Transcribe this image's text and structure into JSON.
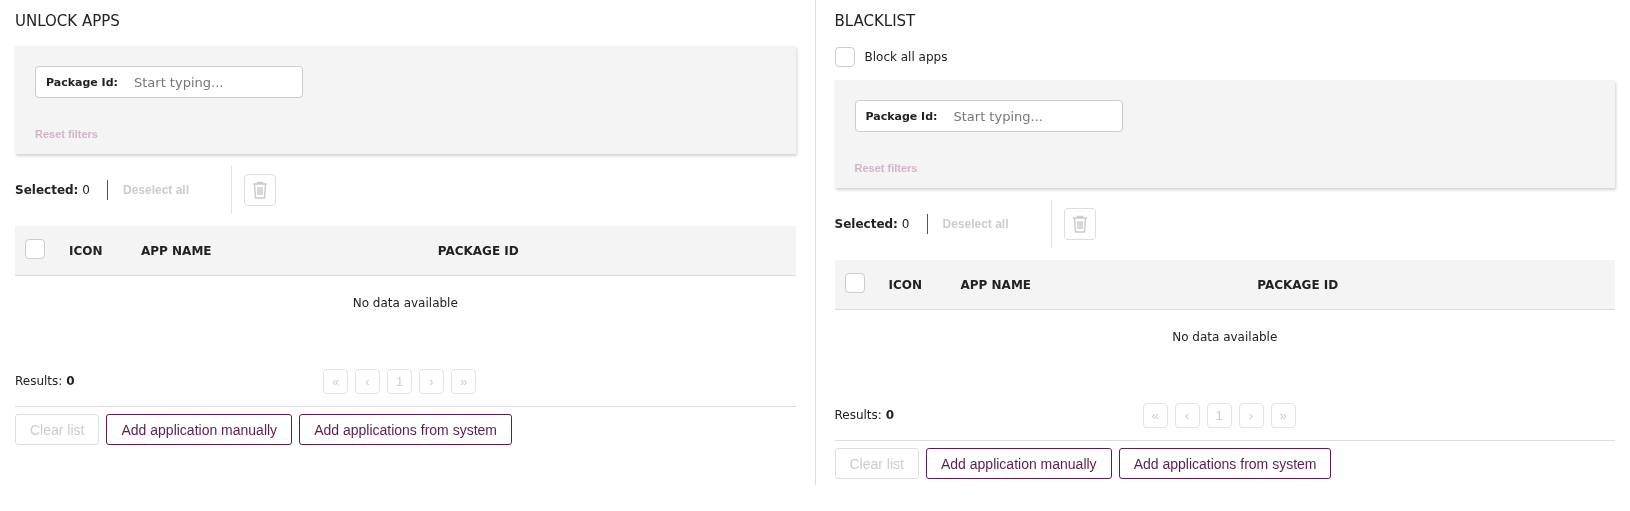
{
  "panels": [
    {
      "title": "UNLOCK APPS",
      "filter": {
        "label": "Package Id:",
        "placeholder": "Start typing...",
        "reset": {
          "label": "Reset filters",
          "disabled": true
        }
      },
      "selection": {
        "label": "Selected:",
        "count": "0",
        "deselect": {
          "label": "Deselect all",
          "disabled": true
        },
        "delete_disabled": true
      },
      "table": {
        "select_all_checked": false,
        "columns": [
          "ICON",
          "APP NAME",
          "PACKAGE ID"
        ],
        "empty": "No data available"
      },
      "results": {
        "label": "Results:",
        "count": "0"
      },
      "pagination": [
        {
          "label": "«",
          "disabled": true
        },
        {
          "label": "‹",
          "disabled": true
        },
        {
          "label": "1",
          "disabled": true
        },
        {
          "label": "›",
          "disabled": true
        },
        {
          "label": "»",
          "disabled": true
        }
      ],
      "buttons": [
        {
          "label": "Clear list",
          "disabled": true
        },
        {
          "label": "Add application manually",
          "disabled": false
        },
        {
          "label": "Add applications from system",
          "disabled": false
        }
      ]
    },
    {
      "title": "BLACKLIST",
      "block_all": {
        "label": "Block all apps",
        "checked": false
      },
      "filter": {
        "label": "Package Id:",
        "placeholder": "Start typing...",
        "reset": {
          "label": "Reset filters",
          "disabled": true
        }
      },
      "selection": {
        "label": "Selected:",
        "count": "0",
        "deselect": {
          "label": "Deselect all",
          "disabled": true
        },
        "delete_disabled": true
      },
      "table": {
        "select_all_checked": false,
        "columns": [
          "ICON",
          "APP NAME",
          "PACKAGE ID"
        ],
        "empty": "No data available"
      },
      "results": {
        "label": "Results:",
        "count": "0"
      },
      "pagination": [
        {
          "label": "«",
          "disabled": true
        },
        {
          "label": "‹",
          "disabled": true
        },
        {
          "label": "1",
          "disabled": true
        },
        {
          "label": "›",
          "disabled": true
        },
        {
          "label": "»",
          "disabled": true
        }
      ],
      "buttons": [
        {
          "label": "Clear list",
          "disabled": true
        },
        {
          "label": "Add application manually",
          "disabled": false
        },
        {
          "label": "Add applications from system",
          "disabled": false
        }
      ]
    }
  ]
}
